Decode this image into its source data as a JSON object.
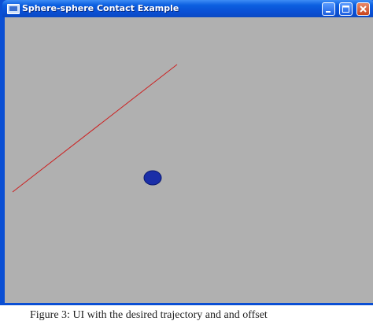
{
  "window": {
    "title": "Sphere-sphere Contact Example",
    "icon": "app-window-icon",
    "controls": {
      "minimize_icon": "minimize-icon",
      "maximize_icon": "maximize-icon",
      "close_icon": "close-icon"
    }
  },
  "scene": {
    "background_color": "#b0b0b0",
    "trajectory_color": "#cc2020",
    "sphere_color": "#1a2ea8"
  },
  "caption": {
    "text": "Figure 3: UI with the desired trajectory and and offset"
  },
  "colors": {
    "titlebar": "#0a4fd4",
    "close_button": "#c9451c"
  }
}
